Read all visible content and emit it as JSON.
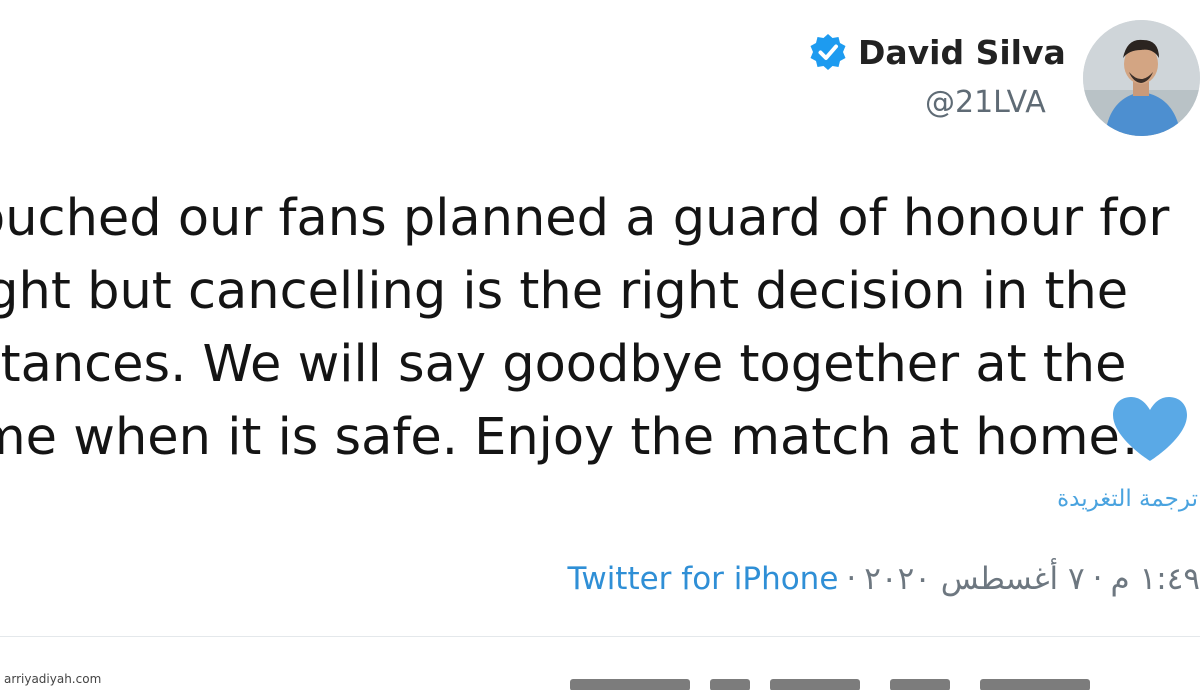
{
  "tweet": {
    "author": {
      "display_name": "David Silva",
      "handle": "@21LVA",
      "verified": true,
      "avatar_icon": "avatar-photo"
    },
    "text_lines": [
      "ouched our fans planned a guard of honour for",
      "ight but cancelling is the right decision in the",
      "stances. We will say goodbye together at the",
      "me when it is safe. Enjoy the match at home!"
    ],
    "emoji": "blue-heart-icon",
    "translate_label": "ترجمة التغريدة",
    "time": "١:٤٩ م",
    "date": "٧ أغسطس ٢٠٢٠",
    "separator": "·",
    "source": "Twitter for iPhone"
  },
  "watermark": "arriyadiyah.com",
  "colors": {
    "verified": "#1d9bf0",
    "link": "#4aa3df",
    "heart": "#5aa9e6",
    "meta_text": "#6d7780"
  }
}
